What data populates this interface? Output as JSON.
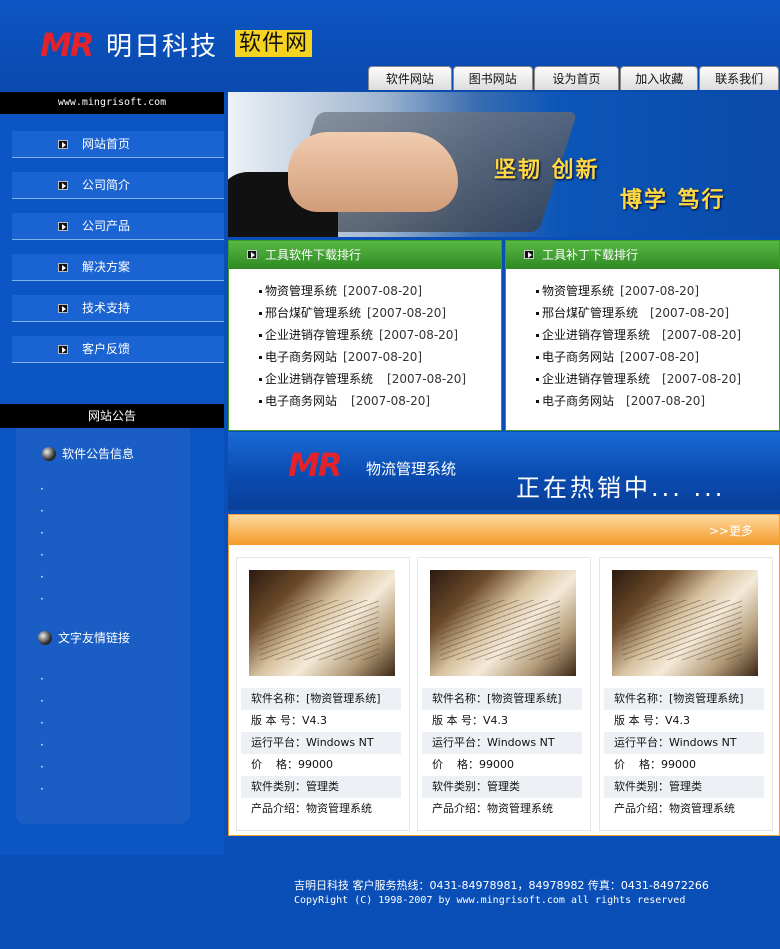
{
  "header": {
    "logo_mark": "MR",
    "site_name": "明日科技",
    "badge": "软件网"
  },
  "topnav": [
    "软件网站",
    "图书网站",
    "设为首页",
    "加入收藏",
    "联系我们"
  ],
  "left": {
    "url": "www.mingrisoft.com",
    "nav": [
      "网站首页",
      "公司简介",
      "公司产品",
      "解决方案",
      "技术支持",
      "客户反馈"
    ],
    "notice_title": "网站公告",
    "section1_title": "软件公告信息",
    "section1_items": [
      "",
      "",
      "",
      "",
      "",
      ""
    ],
    "section2_title": "文字友情链接",
    "section2_items": [
      "",
      "",
      "",
      "",
      "",
      ""
    ]
  },
  "banner": {
    "slogan1": "坚韧 创新",
    "slogan2": "博学 笃行"
  },
  "downloads": {
    "title": "工具软件下载排行",
    "items": [
      {
        "name": "物资管理系统",
        "date": "[2007-08-20]"
      },
      {
        "name": "邢台煤矿管理系统",
        "date": "[2007-08-20]"
      },
      {
        "name": "企业进销存管理系统",
        "date": "[2007-08-20]"
      },
      {
        "name": "电子商务网站",
        "date": "[2007-08-20]"
      },
      {
        "name": "企业进销存管理系统",
        "date": "[2007-08-20]"
      },
      {
        "name": "电子商务网站",
        "date": "[2007-08-20]"
      }
    ]
  },
  "patches": {
    "title": "工具补丁下载排行",
    "items": [
      {
        "name": "物资管理系统",
        "date": "[2007-08-20]"
      },
      {
        "name": "邢台煤矿管理系统",
        "date": "[2007-08-20]"
      },
      {
        "name": "企业进销存管理系统",
        "date": "[2007-08-20]"
      },
      {
        "name": "电子商务网站",
        "date": "[2007-08-20]"
      },
      {
        "name": "企业进销存管理系统",
        "date": "[2007-08-20]"
      },
      {
        "name": "电子商务网站",
        "date": "[2007-08-20]"
      }
    ]
  },
  "promo": {
    "logo_mark": "MR",
    "product": "物流管理系统",
    "hot": "正在热销中... ..."
  },
  "products": {
    "more": ">>更多",
    "cards": [
      {
        "name": "软件名称：[物资管理系统]",
        "version": "版 本 号：V4.3",
        "platform": "运行平台：Windows NT",
        "price": "价    格：99000",
        "category": "软件类别：管理类",
        "intro": "产品介绍：物资管理系统"
      },
      {
        "name": "软件名称：[物资管理系统]",
        "version": "版 本 号：V4.3",
        "platform": "运行平台：Windows NT",
        "price": "价    格：99000",
        "category": "软件类别：管理类",
        "intro": "产品介绍：物资管理系统"
      },
      {
        "name": "软件名称：[物资管理系统]",
        "version": "版 本 号：V4.3",
        "platform": "运行平台：Windows NT",
        "price": "价    格：99000",
        "category": "软件类别：管理类",
        "intro": "产品介绍：物资管理系统"
      }
    ]
  },
  "footer": {
    "line1": "吉明日科技 客户服务热线：0431-84978981，84978982 传真：0431-84972266",
    "line2": "CopyRight (C) 1998-2007 by www.mingrisoft.com all rights reserved"
  }
}
